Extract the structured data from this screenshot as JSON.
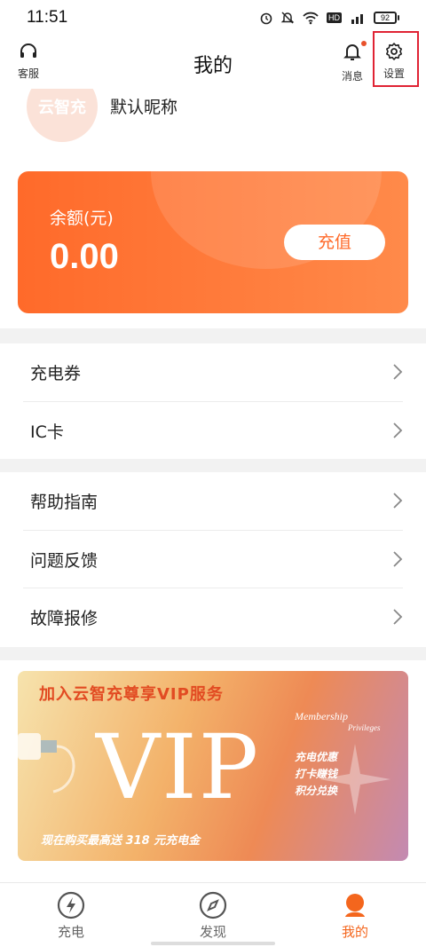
{
  "status_bar": {
    "time": "11:51",
    "battery": "92"
  },
  "header": {
    "title": "我的",
    "service_label": "客服",
    "message_label": "消息",
    "settings_label": "设置"
  },
  "profile": {
    "nickname": "默认昵称",
    "avatar_text": "云智充"
  },
  "balance": {
    "label": "余额(元)",
    "amount": "0.00",
    "recharge_label": "充值"
  },
  "menu_group_1": [
    {
      "label": "充电券"
    },
    {
      "label": "IC卡"
    }
  ],
  "menu_group_2": [
    {
      "label": "帮助指南"
    },
    {
      "label": "问题反馈"
    },
    {
      "label": "故障报修"
    }
  ],
  "vip_banner": {
    "title": "加入云智充尊享VIP服务",
    "big_text": "VIP",
    "membership": "Membership",
    "privileges": "Privileges",
    "perks": [
      "充电优惠",
      "打卡赚钱",
      "积分兑换"
    ],
    "bottom_text": "现在购买最高送 318 元充电金"
  },
  "tabs": [
    {
      "label": "充电",
      "active": false
    },
    {
      "label": "发现",
      "active": false
    },
    {
      "label": "我的",
      "active": true
    }
  ],
  "colors": {
    "accent": "#f4661d",
    "card_start": "#ff6a2a",
    "card_end": "#ff8a4a",
    "highlight_box": "#e02334"
  }
}
